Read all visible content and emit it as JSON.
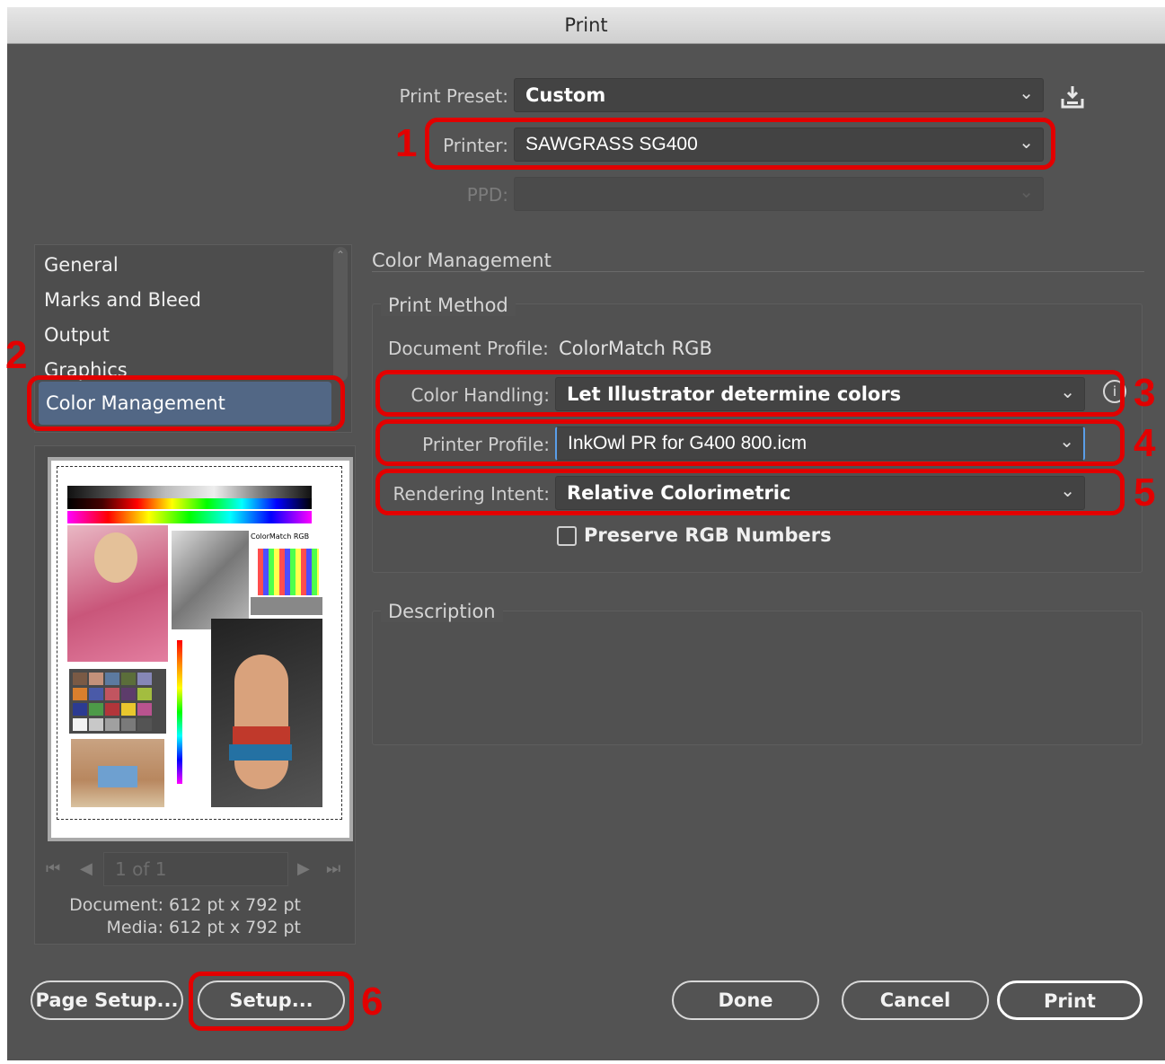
{
  "window": {
    "title": "Print"
  },
  "top": {
    "preset_label": "Print Preset:",
    "preset_value": "Custom",
    "printer_label": "Printer:",
    "printer_value": "SAWGRASS SG400",
    "ppd_label": "PPD:",
    "ppd_value": ""
  },
  "sidebar": {
    "items": [
      {
        "label": "General"
      },
      {
        "label": "Marks and Bleed"
      },
      {
        "label": "Output"
      },
      {
        "label": "Graphics"
      },
      {
        "label": "Color Management"
      }
    ],
    "selected": "Color Management"
  },
  "preview": {
    "page_label": "1 of 1",
    "thumbnail_label": "ColorMatch RGB",
    "document_size": "Document: 612 pt x 792 pt",
    "media_size": "Media: 612 pt x 792 pt"
  },
  "section": {
    "heading": "Color Management",
    "print_method": {
      "legend": "Print Method",
      "doc_profile_label": "Document Profile:",
      "doc_profile_value": "ColorMatch RGB",
      "color_handling_label": "Color Handling:",
      "color_handling_value": "Let Illustrator determine colors",
      "printer_profile_label": "Printer Profile:",
      "printer_profile_value": "InkOwl PR for G400 800.icm",
      "rendering_intent_label": "Rendering Intent:",
      "rendering_intent_value": "Relative Colorimetric",
      "preserve_rgb_label": "Preserve RGB Numbers",
      "preserve_rgb_checked": false
    },
    "description": {
      "legend": "Description",
      "text": ""
    }
  },
  "buttons": {
    "page_setup": "Page Setup...",
    "setup": "Setup...",
    "done": "Done",
    "cancel": "Cancel",
    "print": "Print"
  },
  "annotations": [
    "1",
    "2",
    "3",
    "4",
    "5",
    "6"
  ],
  "colors": {
    "dialog_bg": "#535353",
    "field_bg": "#434343",
    "selected_item": "#526785",
    "annotation_red": "#e20000"
  }
}
